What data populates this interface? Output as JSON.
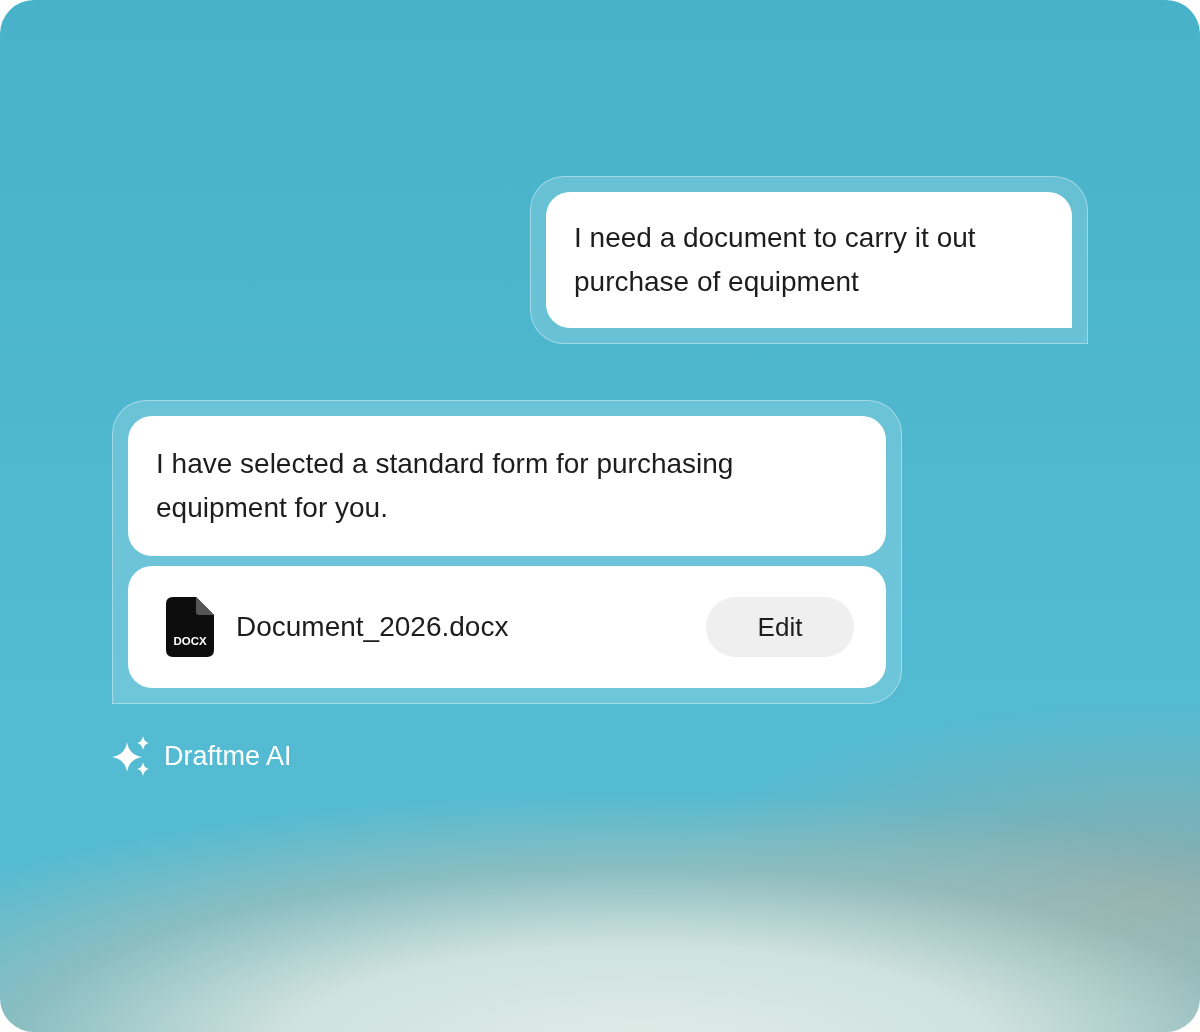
{
  "messages": [
    {
      "kind": "sent",
      "text": "I need a document to carry it out purchase of equipment"
    },
    {
      "kind": "received",
      "text": "I have selected a standard form for purchasing equipment for you.",
      "attachment": {
        "file_type": "DOCX",
        "name": "Document_2026.docx",
        "action": "Edit"
      }
    }
  ],
  "brand": "Draftme AI"
}
